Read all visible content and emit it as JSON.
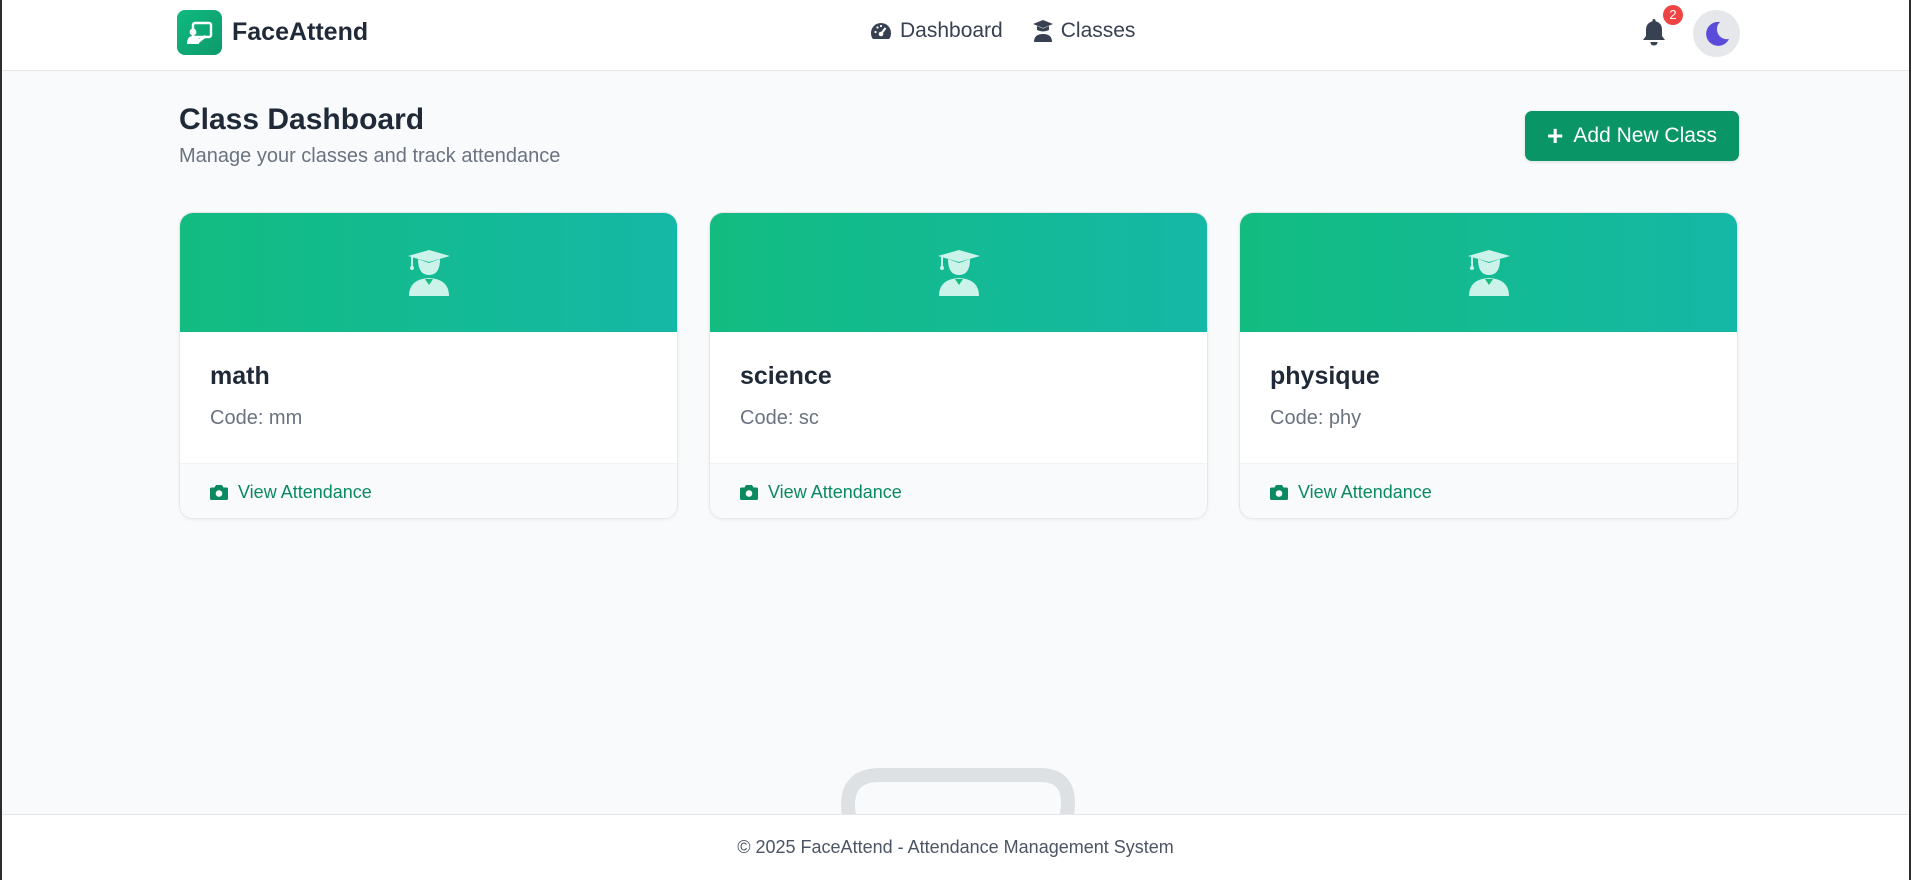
{
  "app": {
    "name": "FaceAttend",
    "logo_icon": "presentation-board-icon"
  },
  "nav": {
    "items": [
      {
        "label": "Dashboard",
        "icon": "gauge-icon"
      },
      {
        "label": "Classes",
        "icon": "student-icon"
      }
    ]
  },
  "notifications": {
    "count": "2",
    "icon": "bell-icon"
  },
  "theme_toggle": {
    "icon": "moon-icon"
  },
  "page": {
    "title": "Class Dashboard",
    "subtitle": "Manage your classes and track attendance"
  },
  "add_button": {
    "label": "Add New Class",
    "icon": "plus-icon"
  },
  "classes": [
    {
      "name": "math",
      "code": "Code: mm",
      "action": "View Attendance",
      "icon": "graduate-icon"
    },
    {
      "name": "science",
      "code": "Code: sc",
      "action": "View Attendance",
      "icon": "graduate-icon"
    },
    {
      "name": "physique",
      "code": "Code: phy",
      "action": "View Attendance",
      "icon": "graduate-icon"
    }
  ],
  "footer": {
    "text": "© 2025 FaceAttend - Attendance Management System"
  },
  "colors": {
    "primary": "#0a9566",
    "banner_start": "#12bc80",
    "banner_end": "#14b8a6",
    "badge": "#ef4444",
    "moon": "#5b4bdb"
  }
}
